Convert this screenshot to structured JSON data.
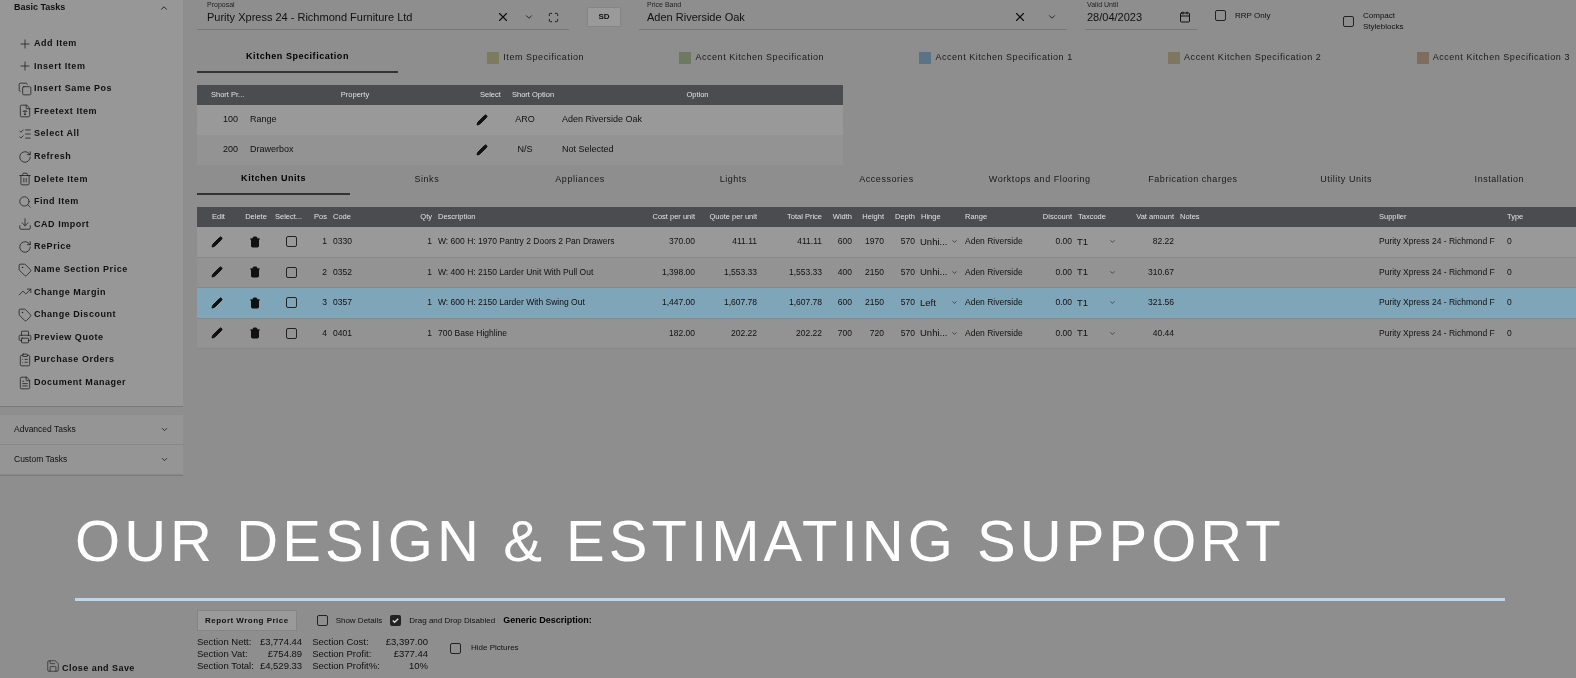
{
  "sidebar": {
    "basic_tasks": {
      "title": "Basic Tasks",
      "expanded": true,
      "items": [
        {
          "label": "Add Item"
        },
        {
          "label": "Insert Item"
        },
        {
          "label": "Insert Same Pos"
        },
        {
          "label": "Freetext Item"
        },
        {
          "label": "Select All"
        },
        {
          "label": "Refresh"
        },
        {
          "label": "Delete Item"
        },
        {
          "label": "Find Item"
        },
        {
          "label": "CAD Import"
        },
        {
          "label": "RePrice"
        },
        {
          "label": "Name Section Price"
        },
        {
          "label": "Change Margin"
        },
        {
          "label": "Change Discount"
        },
        {
          "label": "Preview Quote"
        },
        {
          "label": "Purchase Orders"
        },
        {
          "label": "Document Manager"
        }
      ]
    },
    "sections": [
      {
        "title": "Advanced Tasks",
        "expanded": false
      },
      {
        "title": "Custom Tasks",
        "expanded": false
      }
    ],
    "close_and_save": "Close and Save"
  },
  "header": {
    "proposal": {
      "label": "Proposal",
      "value": "Purity Xpress 24 - Richmond Furniture Ltd"
    },
    "sd_button": "SD",
    "price_band": {
      "label": "Price Band",
      "value": "Aden Riverside Oak"
    },
    "valid_until": {
      "label": "Valid Until",
      "value": "28/04/2023"
    },
    "options": [
      {
        "label": "RRP Only",
        "checked": false
      },
      {
        "label": "Compact Styleblocks",
        "checked": false
      }
    ]
  },
  "spec_tabs": [
    {
      "label": "Kitchen Specification",
      "selected": true
    },
    {
      "label": "Item Specification",
      "selected": false,
      "color": "#7d7a5e"
    },
    {
      "label": "Accent Kitchen Specification",
      "selected": false,
      "color": "#6d7a5f"
    },
    {
      "label": "Accent Kitchen Specification 1",
      "selected": false,
      "color": "#5c7286"
    },
    {
      "label": "Accent Kitchen Specification 2",
      "selected": false,
      "color": "#7f7660"
    },
    {
      "label": "Accent Kitchen Specification 3",
      "selected": false,
      "color": "#7e6c5f"
    }
  ],
  "spec_table": {
    "columns": [
      "Short Pr...",
      "Property",
      "Select",
      "Short Option",
      "Option"
    ],
    "rows": [
      {
        "short": "100",
        "property": "Range",
        "short_option": "ARO",
        "option": "Aden Riverside Oak"
      },
      {
        "short": "200",
        "property": "Drawerbox",
        "short_option": "N/S",
        "option": "Not Selected"
      }
    ]
  },
  "unit_tabs": [
    {
      "label": "Kitchen Units",
      "selected": true
    },
    {
      "label": "Sinks",
      "selected": false
    },
    {
      "label": "Appliances",
      "selected": false
    },
    {
      "label": "Lights",
      "selected": false
    },
    {
      "label": "Accessories",
      "selected": false
    },
    {
      "label": "Worktops and Flooring",
      "selected": false
    },
    {
      "label": "Fabrication charges",
      "selected": false
    },
    {
      "label": "Utility Units",
      "selected": false
    },
    {
      "label": "Installation",
      "selected": false
    }
  ],
  "units_table": {
    "columns": [
      {
        "label": "Edit",
        "kind": "edit"
      },
      {
        "label": "Delete",
        "kind": "delete"
      },
      {
        "label": "Select...",
        "kind": "select"
      },
      {
        "label": "Pos",
        "kind": "num"
      },
      {
        "label": "Code",
        "kind": "text"
      },
      {
        "label": "Qty",
        "kind": "num"
      },
      {
        "label": "Description",
        "kind": "text"
      },
      {
        "label": "Cost per unit",
        "kind": "num"
      },
      {
        "label": "Quote per unit",
        "kind": "num"
      },
      {
        "label": "Total Price",
        "kind": "num"
      },
      {
        "label": "Width",
        "kind": "num"
      },
      {
        "label": "Height",
        "kind": "num"
      },
      {
        "label": "Depth",
        "kind": "num"
      },
      {
        "label": "Hinge",
        "kind": "dropdown"
      },
      {
        "label": "Range",
        "kind": "text"
      },
      {
        "label": "Discount",
        "kind": "num"
      },
      {
        "label": "Taxcode",
        "kind": "dropdown"
      },
      {
        "label": "Vat amount",
        "kind": "num"
      },
      {
        "label": "Notes",
        "kind": "blank"
      },
      {
        "label": "Supplier",
        "kind": "text"
      },
      {
        "label": "Type",
        "kind": "text"
      }
    ],
    "rows": [
      {
        "selected": false,
        "checked": false,
        "values": [
          "1",
          "0330",
          "1",
          "W: 600 H: 1970 Pantry 2 Doors 2 Pan Drawers",
          "370.00",
          "411.11",
          "411.11",
          "600",
          "1970",
          "570",
          "Unhi...",
          "Aden Riverside",
          "0.00",
          "T1",
          "82.22",
          "Purity Xpress 24 - Richmond F",
          "0"
        ]
      },
      {
        "selected": false,
        "checked": false,
        "values": [
          "2",
          "0352",
          "1",
          "W: 400 H: 2150 Larder Unit With Pull Out",
          "1,398.00",
          "1,553.33",
          "1,553.33",
          "400",
          "2150",
          "570",
          "Unhi...",
          "Aden Riverside",
          "0.00",
          "T1",
          "310.67",
          "Purity Xpress 24 - Richmond F",
          "0"
        ]
      },
      {
        "selected": true,
        "checked": false,
        "values": [
          "3",
          "0357",
          "1",
          "W: 600 H: 2150 Larder With Swing Out",
          "1,447.00",
          "1,607.78",
          "1,607.78",
          "600",
          "2150",
          "570",
          "Left",
          "Aden Riverside",
          "0.00",
          "T1",
          "321.56",
          "Purity Xpress 24 - Richmond F",
          "0"
        ]
      },
      {
        "selected": false,
        "checked": false,
        "values": [
          "4",
          "0401",
          "1",
          "700 Base Highline",
          "182.00",
          "202.22",
          "202.22",
          "700",
          "720",
          "570",
          "Unhi...",
          "Aden Riverside",
          "0.00",
          "T1",
          "40.44",
          "Purity Xpress 24 - Richmond F",
          "0"
        ]
      }
    ]
  },
  "footer": {
    "report_button": "Report Wrong Price",
    "options": [
      {
        "label": "Show Details",
        "checked": false
      },
      {
        "label": "Drag and Drop Disabled",
        "checked": true
      }
    ],
    "generic_description": "Generic Description:",
    "totals_left": [
      {
        "label": "Section Nett:",
        "value": "£3,774.44"
      },
      {
        "label": "Section Vat:",
        "value": "£754.89"
      },
      {
        "label": "Section Total:",
        "value": "£4,529.33"
      }
    ],
    "totals_right": [
      {
        "label": "Section Cost:",
        "value": "£3,397.00"
      },
      {
        "label": "Section Profit:",
        "value": "£377.44"
      },
      {
        "label": "Section Profit%:",
        "value": "10%"
      }
    ],
    "hide_pictures": {
      "label": "Hide Pictures",
      "checked": false
    }
  },
  "banner": {
    "heading": "OUR DESIGN & ESTIMATING SUPPORT"
  }
}
